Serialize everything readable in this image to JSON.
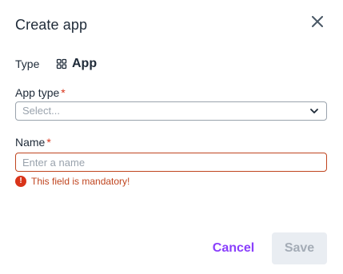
{
  "dialog": {
    "title": "Create app",
    "close_icon": "close-icon"
  },
  "type_row": {
    "label": "Type",
    "icon": "app-grid-icon",
    "value": "App"
  },
  "app_type": {
    "label": "App type",
    "required_marker": "*",
    "placeholder": "Select...",
    "icon": "chevron-down-icon"
  },
  "name": {
    "label": "Name",
    "required_marker": "*",
    "placeholder": "Enter a name",
    "value": "",
    "error_icon": "error-icon",
    "error_glyph": "!",
    "error_text": "This field is mandatory!"
  },
  "footer": {
    "cancel_label": "Cancel",
    "save_label": "Save"
  },
  "colors": {
    "accent": "#8a3ffc",
    "error": "#d9341a",
    "text": "#1e2a38",
    "disabled_bg": "#e9edf2",
    "disabled_text": "#a4acb6"
  }
}
